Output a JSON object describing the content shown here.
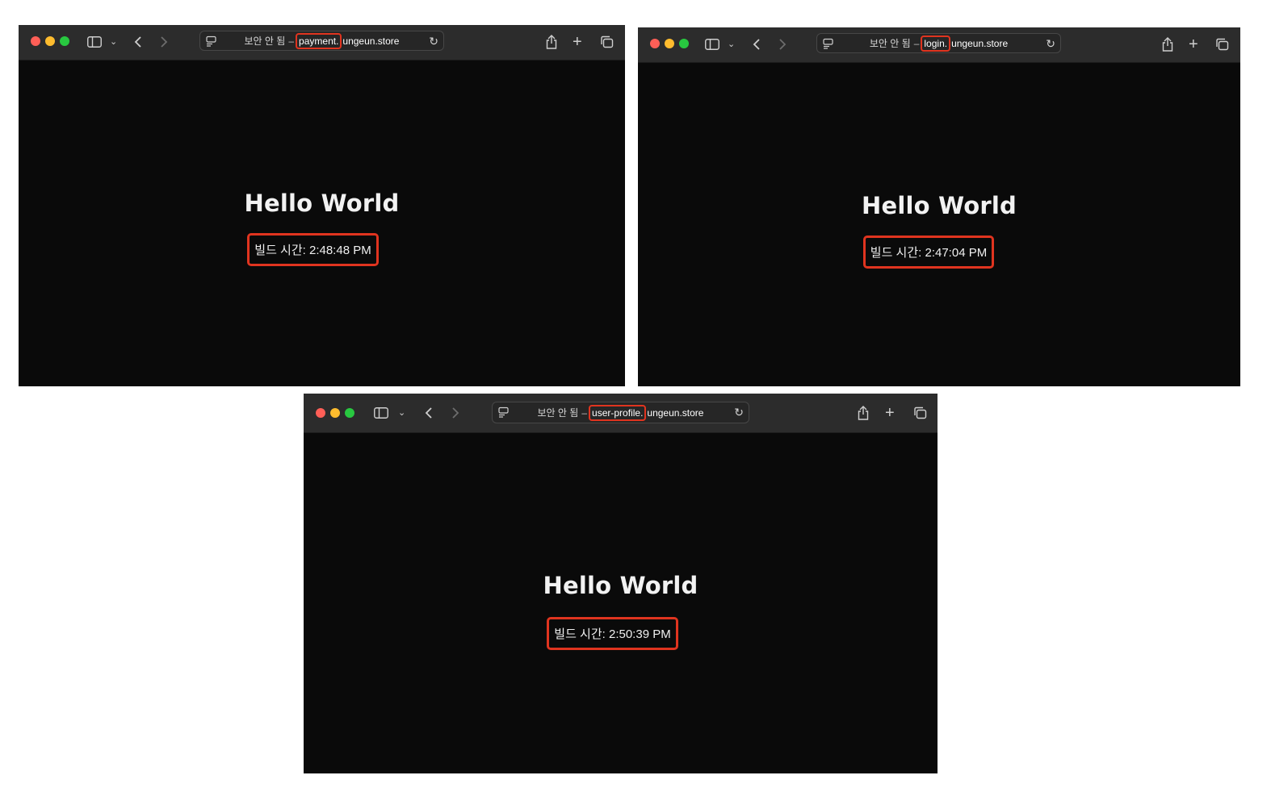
{
  "windows": [
    {
      "security_label": "보안 안 됨",
      "separator": "–",
      "subdomain": "payment.",
      "domain": "ungeun.store",
      "heading": "Hello World",
      "build_time": "빌드 시간: 2:48:48 PM"
    },
    {
      "security_label": "보안 안 됨",
      "separator": "–",
      "subdomain": "login.",
      "domain": "ungeun.store",
      "heading": "Hello World",
      "build_time": "빌드 시간: 2:47:04 PM"
    },
    {
      "security_label": "보안 안 됨",
      "separator": "–",
      "subdomain": "user-profile.",
      "domain": "ungeun.store",
      "heading": "Hello World",
      "build_time": "빌드 시간: 2:50:39 PM"
    }
  ],
  "colors": {
    "highlight": "#e0341f",
    "page_background": "#0a0a0a",
    "toolbar": "#2c2c2c"
  },
  "icons": {
    "sidebar": "sidebar-icon",
    "chevron": "chevron-down-icon",
    "back": "back-arrow-icon",
    "forward": "forward-arrow-icon",
    "page": "page-menu-icon",
    "reload": "reload-icon",
    "share": "share-icon",
    "new_tab": "new-tab-icon",
    "tabs": "tab-overview-icon"
  }
}
